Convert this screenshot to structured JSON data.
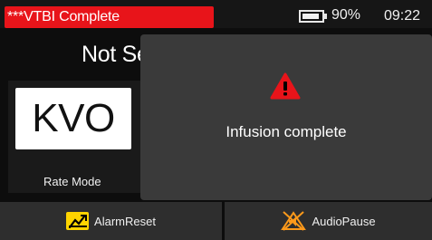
{
  "status": {
    "alarm_text": "***VTBI Complete",
    "battery_percent": "90%",
    "battery_level": 0.9,
    "time": "09:22"
  },
  "main": {
    "status_text": "Not Se",
    "mode_value": "KVO",
    "mode_label": "Rate Mode"
  },
  "popup": {
    "icon": "warning-triangle-icon",
    "message": "Infusion complete"
  },
  "buttons": {
    "alarm_reset": "AlarmReset",
    "audio_pause": "AudioPause"
  },
  "colors": {
    "alarm_red": "#e8141a",
    "warning_red": "#e8141a",
    "reset_yellow": "#ffd400",
    "pause_orange": "#ff9a1a"
  }
}
